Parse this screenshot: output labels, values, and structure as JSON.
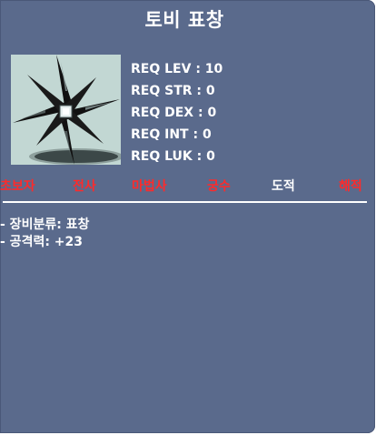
{
  "item": {
    "name": "토비 표창",
    "icon": "throwing-star-icon"
  },
  "requirements": [
    {
      "label": "REQ LEV : 10"
    },
    {
      "label": "REQ STR : 0"
    },
    {
      "label": "REQ DEX : 0"
    },
    {
      "label": "REQ INT : 0"
    },
    {
      "label": "REQ LUK : 0"
    }
  ],
  "jobs": [
    {
      "label": "초보자",
      "color": "#ff2a2a"
    },
    {
      "label": "전사",
      "color": "#ff2a2a"
    },
    {
      "label": "마법사",
      "color": "#ff2a2a"
    },
    {
      "label": "궁수",
      "color": "#ff2a2a"
    },
    {
      "label": "도적",
      "color": "#ffffff"
    },
    {
      "label": "해적",
      "color": "#ff2a2a"
    }
  ],
  "description": [
    {
      "text": "- 장비분류: 표창"
    },
    {
      "text": "- 공격력: +23"
    }
  ],
  "colors": {
    "panel": "#5a6a8c",
    "icon_bg": "#c2d7d3",
    "unavailable_job": "#ff2a2a",
    "available_job": "#ffffff"
  }
}
